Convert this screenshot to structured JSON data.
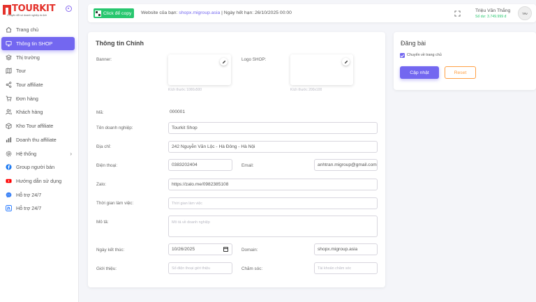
{
  "brand": {
    "name": "TOURKIT",
    "tagline": "Chuyên đổi số doanh nghiệp du lịch",
    "color": "#e4322b"
  },
  "colors": {
    "accent": "#7367f0",
    "success": "#28c76f",
    "warning": "#ff9f43"
  },
  "sidebar": {
    "items": [
      {
        "label": "Trang chủ",
        "icon": "home-icon"
      },
      {
        "label": "Thông tin SHOP",
        "icon": "monitor-icon",
        "active": true
      },
      {
        "label": "Thị trường",
        "icon": "layers-icon"
      },
      {
        "label": "Tour",
        "icon": "map-icon"
      },
      {
        "label": "Tour affiliate",
        "icon": "share-icon"
      },
      {
        "label": "Đơn hàng",
        "icon": "cart-icon"
      },
      {
        "label": "Khách hàng",
        "icon": "users-icon"
      },
      {
        "label": "Kho Tour affiliate",
        "icon": "box-icon"
      },
      {
        "label": "Doanh thu affiliate",
        "icon": "bar-chart-icon"
      },
      {
        "label": "Hệ thống",
        "icon": "gear-icon"
      },
      {
        "label": "Group người bán",
        "icon": "facebook-icon"
      },
      {
        "label": "Hướng dẫn sử dụng",
        "icon": "youtube-icon"
      },
      {
        "label": "Hỗ trợ 24/7",
        "icon": "messenger-icon"
      },
      {
        "label": "Hỗ trợ 24/7",
        "icon": "zalo-icon"
      }
    ]
  },
  "header": {
    "copy_label": "Click để copy",
    "site_prefix": "Website của bạn: ",
    "site_url": "shopx.migroup.asia",
    "expiry_text": " | Ngày hết hạn: 26/10/2025 00:00",
    "user_name": "Triệu Văn Thắng",
    "balance": "Số dư: 3.749.999 đ",
    "avatar_text": "TRV"
  },
  "main": {
    "title": "Thông tin Chính",
    "banner_label": "Banner:",
    "banner_hint": "Kích thước 1000x500",
    "logo_label": "Logo SHOP:",
    "logo_hint": "Kích thước 200x100",
    "id_label": "Mã:",
    "id_value": "000001",
    "company_label": "Tên doanh nghiệp:",
    "company_value": "Tourkit Shop",
    "address_label": "Địa chỉ:",
    "address_value": "242 Nguyễn Văn Lộc - Hà Đông - Hà Nội",
    "phone_label": "Điện thoại:",
    "phone_value": "0383202404",
    "email_label": "Email:",
    "email_value": "anhtran.migroup@gmail.com",
    "zalo_label": "Zalo:",
    "zalo_value": "https://zalo.me/0982385108",
    "hours_label": "Thời gian làm việc:",
    "hours_placeholder": "Thời gian làm việc",
    "desc_label": "Mô tả:",
    "desc_placeholder": "Mô tả về doanh nghiệp",
    "end_label": "Ngày kết thúc:",
    "end_value": "10/26/2025",
    "domain_label": "Domain:",
    "domain_value": "shopx.migroup.asia",
    "referrer_label": "Giới thiệu:",
    "referrer_placeholder": "Số điện thoại giới thiệu",
    "care_label": "Chăm sóc:",
    "care_placeholder": "Tài khoản chăm sóc"
  },
  "publish": {
    "title": "Đăng bài",
    "checkbox_label": "Chuyển về trang chủ",
    "checked": true,
    "update_label": "Cập nhật",
    "reset_label": "Reset"
  }
}
